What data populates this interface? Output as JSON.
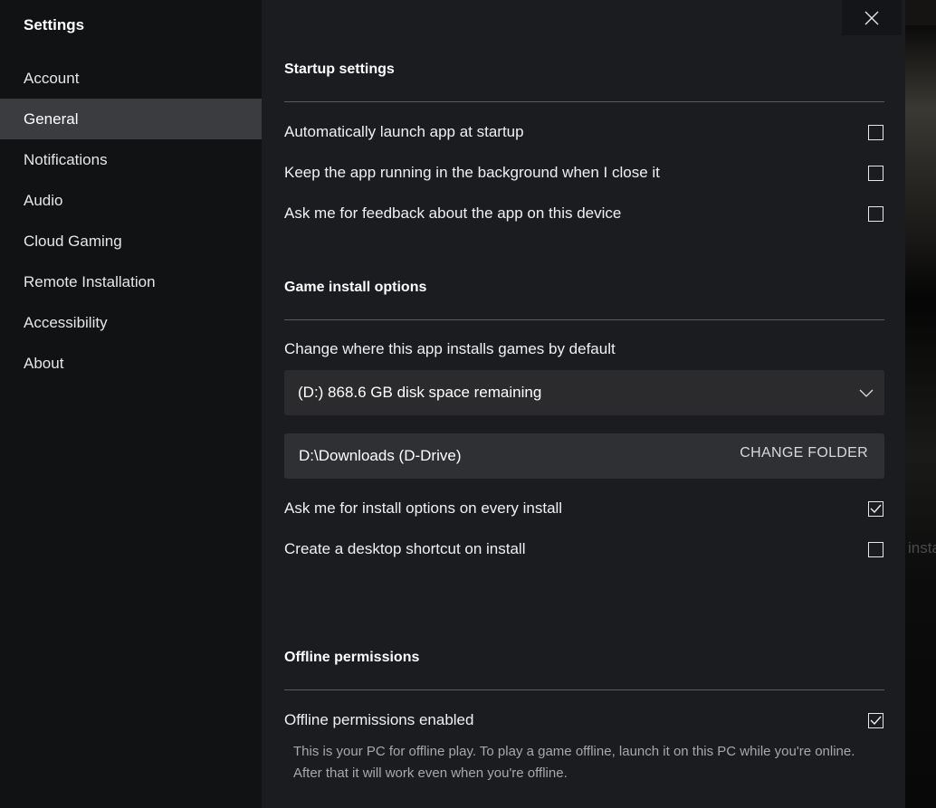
{
  "background": {
    "partial_text": "insta"
  },
  "sidebar": {
    "title": "Settings",
    "items": [
      {
        "label": "Account",
        "active": false
      },
      {
        "label": "General",
        "active": true
      },
      {
        "label": "Notifications",
        "active": false
      },
      {
        "label": "Audio",
        "active": false
      },
      {
        "label": "Cloud Gaming",
        "active": false
      },
      {
        "label": "Remote Installation",
        "active": false
      },
      {
        "label": "Accessibility",
        "active": false
      },
      {
        "label": "About",
        "active": false
      }
    ]
  },
  "main": {
    "close_icon": "close-x",
    "startup": {
      "heading": "Startup settings",
      "options": [
        {
          "label": "Automatically launch app at startup",
          "checked": false
        },
        {
          "label": "Keep the app running in the background when I close it",
          "checked": false
        },
        {
          "label": "Ask me for feedback about the app on this device",
          "checked": false
        }
      ]
    },
    "install": {
      "heading": "Game install options",
      "location_label": "Change where this app installs games by default",
      "drive_select": "(D:) 868.6 GB disk space remaining",
      "folder_path": "D:\\Downloads (D-Drive)",
      "change_folder_label": "CHANGE FOLDER",
      "options": [
        {
          "label": "Ask me for install options on every install",
          "checked": true
        },
        {
          "label": "Create a desktop shortcut on install",
          "checked": false
        }
      ]
    },
    "offline": {
      "heading": "Offline permissions",
      "option": {
        "label": "Offline permissions enabled",
        "checked": true
      },
      "description": "This is your PC for offline play. To play a game offline, launch it on this PC while you're online. After that it will work even when you're offline."
    }
  }
}
